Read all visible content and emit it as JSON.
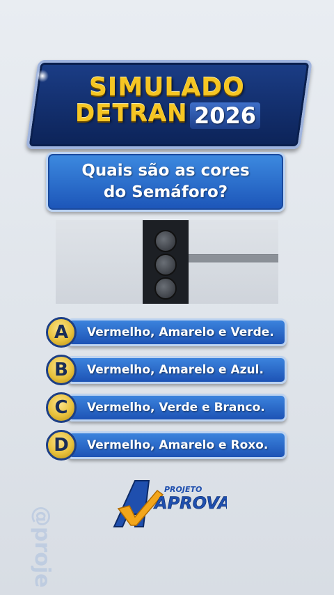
{
  "banner": {
    "title_line1": "SIMULADO",
    "title_line2": "DETRAN",
    "year": "2026"
  },
  "question": {
    "text": "Quais são as cores\ndo Semáforo?"
  },
  "answers": [
    {
      "letter": "A",
      "text": "Vermelho, Amarelo e Verde."
    },
    {
      "letter": "B",
      "text": "Vermelho, Amarelo e Azul."
    },
    {
      "letter": "C",
      "text": "Vermelho, Verde e Branco."
    },
    {
      "letter": "D",
      "text": "Vermelho, Amarelo e Roxo."
    }
  ],
  "logo": {
    "small": "PROJETO",
    "big": "APROVA"
  },
  "watermark": "@proje",
  "colors": {
    "gold": "#f6c623",
    "navy": "#0c2358",
    "blue": "#1d53b5"
  }
}
